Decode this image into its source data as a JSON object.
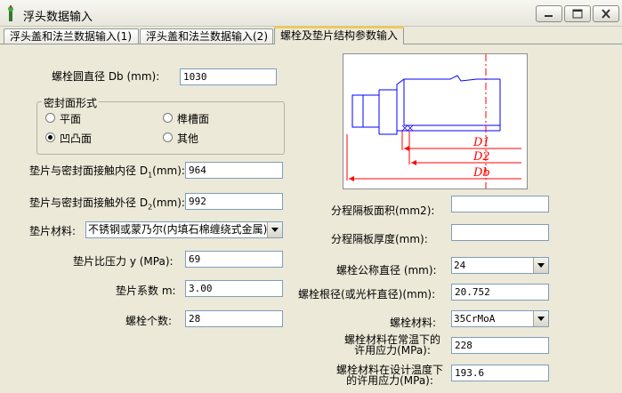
{
  "window": {
    "title": "浮头数据输入",
    "icon": "flag-icon",
    "controls": [
      "minimize-icon",
      "maximize-icon",
      "close-icon"
    ]
  },
  "tabs": [
    {
      "label": "浮头盖和法兰数据输入(1)",
      "active": false
    },
    {
      "label": "浮头盖和法兰数据输入(2)",
      "active": false
    },
    {
      "label": "螺栓及垫片结构参数输入",
      "active": true
    }
  ],
  "form": {
    "bolt_circle_diameter": {
      "label": "螺栓圆直径 Db (mm):",
      "value": "1030"
    },
    "seal_face": {
      "title": "密封面形式",
      "options": [
        {
          "label": "平面",
          "checked": false
        },
        {
          "label": "榫槽面",
          "checked": false
        },
        {
          "label": "凹凸面",
          "checked": true
        },
        {
          "label": "其他",
          "checked": false
        }
      ]
    },
    "gasket_inner_diameter": {
      "label_prefix": "垫片与密封面接触内径 D",
      "label_sub": "1",
      "label_suffix": "(mm):",
      "value": "964"
    },
    "gasket_outer_diameter": {
      "label_prefix": "垫片与密封面接触外径 D",
      "label_sub": "2",
      "label_suffix": "(mm):",
      "value": "992"
    },
    "gasket_material": {
      "label": "垫片材料:",
      "value": "不锈钢或蒙乃尔(内填石棉缠绕式金属)"
    },
    "gasket_specific_pressure": {
      "label": "垫片比压力 y (MPa):",
      "value": "69"
    },
    "gasket_factor": {
      "label": "垫片系数 m:",
      "value": "3.00"
    },
    "bolt_count": {
      "label": "螺栓个数:",
      "value": "28"
    },
    "pass_partition_area": {
      "label": "分程隔板面积(mm2):",
      "value": ""
    },
    "pass_partition_thickness": {
      "label": "分程隔板厚度(mm):",
      "value": ""
    },
    "bolt_nominal_diameter": {
      "label": "螺栓公称直径 (mm):",
      "value": "24"
    },
    "bolt_root_diameter": {
      "label": "螺栓根径(或光杆直径)(mm):",
      "value": "20.752"
    },
    "bolt_material": {
      "label": "螺栓材料:",
      "value": "35CrMoA"
    },
    "bolt_allow_stress_normal": {
      "label_line1": "螺栓材料在常温下的",
      "label_line2": "许用应力(MPa):",
      "value": "228"
    },
    "bolt_allow_stress_design": {
      "label_line1": "螺栓材料在设计温度下",
      "label_line2": "的许用应力(MPa):",
      "value": "193.6"
    }
  },
  "diagram": {
    "labels": {
      "d1": "D1",
      "d2": "D2",
      "db": "Db"
    },
    "colors": {
      "outline": "#0000ff",
      "dims": "#ff0000"
    }
  },
  "colors": {
    "background": "#ece9d8",
    "field_border": "#7f9db9",
    "tab_highlight": "#ffc83c"
  }
}
